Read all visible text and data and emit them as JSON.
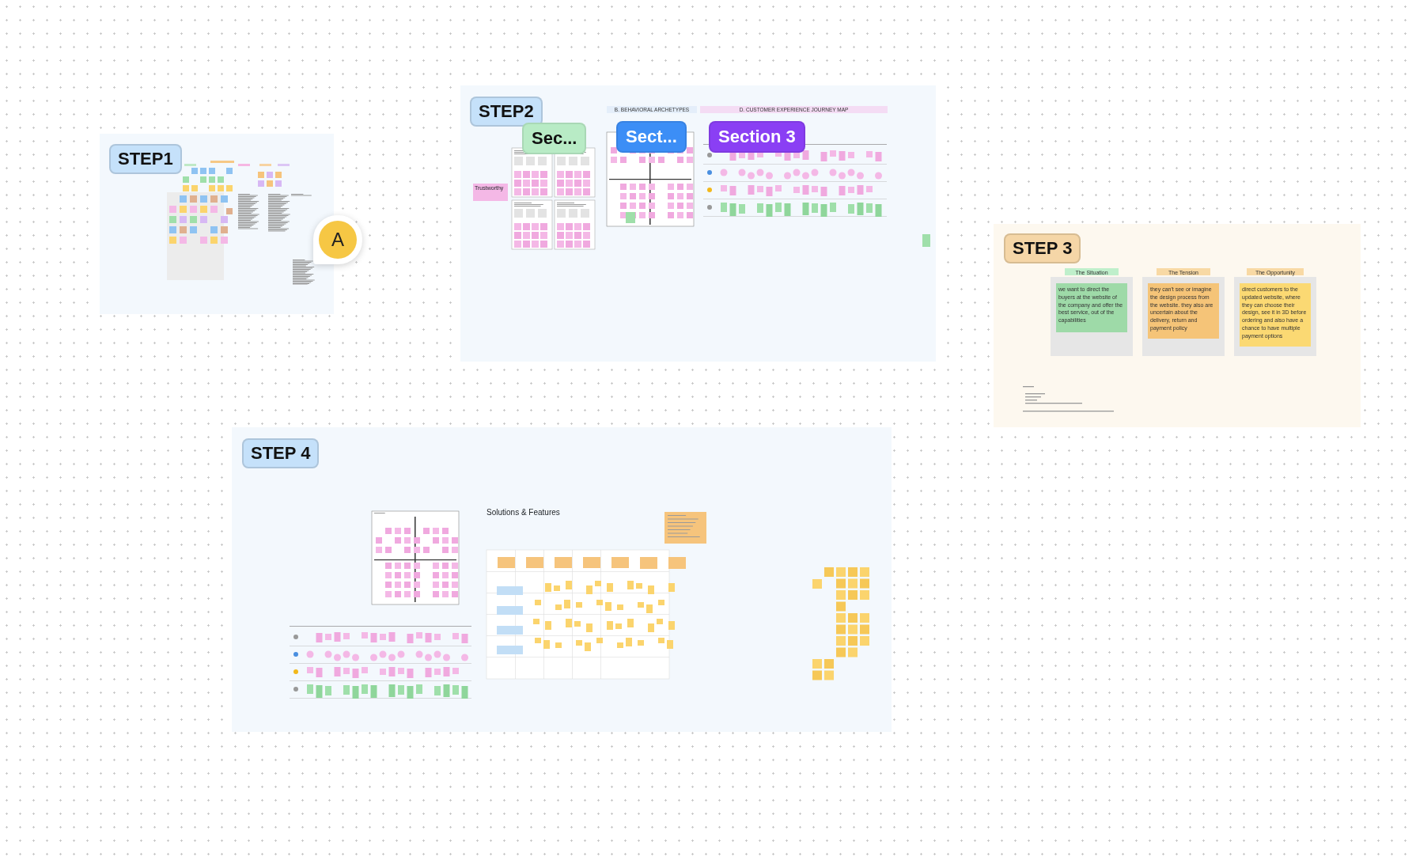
{
  "frames": [
    {
      "label": "STEP1",
      "color": "#c5e1fa"
    },
    {
      "label": "STEP2",
      "color": "#c5e1fa",
      "sections": [
        {
          "label": "Sec...",
          "color": "#b8ebc5"
        },
        {
          "label": "Sect...",
          "color": "#3c8ef6"
        },
        {
          "label": "Section 3",
          "color": "#8a3ff4"
        }
      ],
      "headers": [
        "B. BEHAVIORAL ARCHETYPES",
        "D. CUSTOMER EXPERIENCE JOURNEY MAP"
      ],
      "sticky": "Trustworthy"
    },
    {
      "label": "STEP 3",
      "color": "#f5d6a7",
      "cards": [
        {
          "title": "The Situation",
          "text": "we want to direct the buyers at the website of the company and offer the best service, out of the capabilities",
          "color": "#9edaa8"
        },
        {
          "title": "The Tension",
          "text": "they can't see or imagine the design process from the website. they also are uncertain about the delivery, return and payment policy",
          "color": "#f5c478"
        },
        {
          "title": "The Opportunity",
          "text": "direct customers to the updated website, where they can choose their design, see it in 3D before ordering and also have a chance to have multiple payment options",
          "color": "#fbd973"
        }
      ]
    },
    {
      "label": "STEP 4",
      "color": "#c5e1fa",
      "heading": "Solutions & Features"
    }
  ],
  "collaborators": [
    {
      "initial": "A",
      "color": "#f6c744"
    }
  ]
}
